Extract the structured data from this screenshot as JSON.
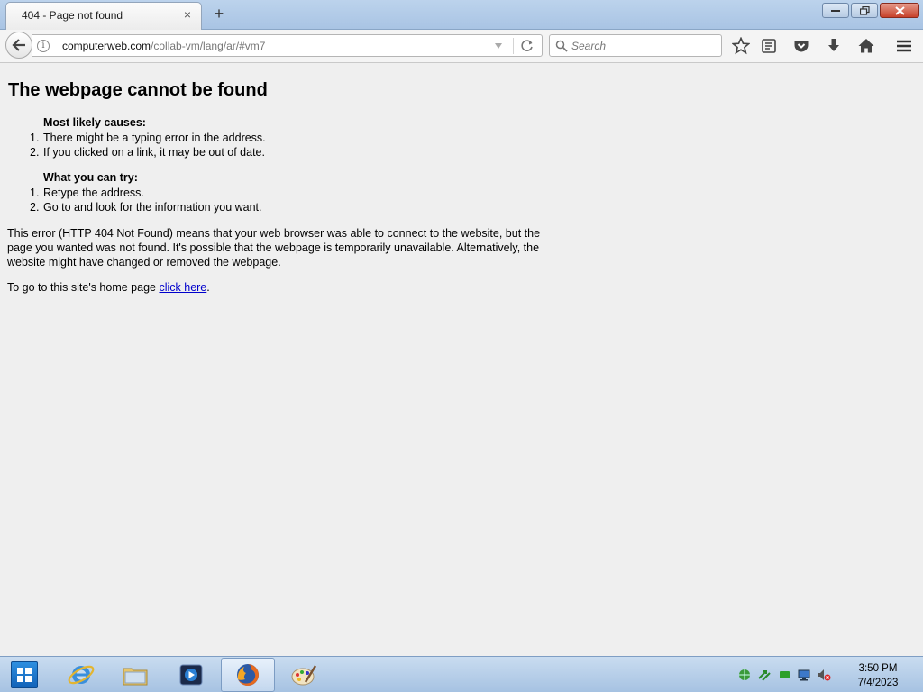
{
  "window": {
    "tab_title": "404 - Page not found",
    "close_tab_symbol": "×",
    "new_tab_symbol": "+"
  },
  "navbar": {
    "url_host": "computerweb.com",
    "url_path": "/collab-vm/lang/ar/#vm7",
    "search_placeholder": "Search"
  },
  "page": {
    "heading": "The webpage cannot be found",
    "causes_title": "Most likely causes:",
    "causes": [
      {
        "num": "1.",
        "text": "There might be a typing error in the address."
      },
      {
        "num": "2.",
        "text": "If you clicked on a link, it may be out of date."
      }
    ],
    "try_title": "What you can try:",
    "tries": [
      {
        "num": "1.",
        "text": "Retype the address."
      },
      {
        "num": "2.",
        "text": "Go to and look for the information you want."
      }
    ],
    "explanation": "This error (HTTP 404 Not Found) means that your web browser was able to connect to the website, but the page you wanted was not found. It's possible that the webpage is temporarily unavailable. Alternatively, the website might have changed or removed the webpage.",
    "home_prefix": "To go to this site's home page ",
    "home_link": "click here",
    "home_suffix": "."
  },
  "taskbar": {
    "apps": [
      "internet-explorer-icon",
      "file-explorer-icon",
      "media-player-icon",
      "firefox-icon",
      "paint-icon"
    ],
    "active_app": "firefox-icon",
    "clock_time": "3:50 PM",
    "clock_date": "7/4/2023"
  },
  "colors": {
    "page_bg": "#efefef",
    "link": "#0000cc",
    "titlebar": "#b4cdea",
    "taskbar": "#b6cde8"
  }
}
